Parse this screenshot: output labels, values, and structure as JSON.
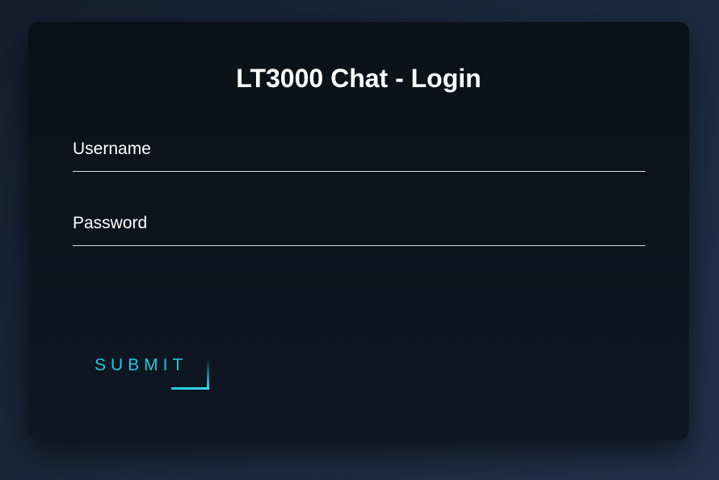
{
  "login": {
    "title": "LT3000 Chat - Login",
    "username": {
      "label": "Username",
      "value": ""
    },
    "password": {
      "label": "Password",
      "value": ""
    },
    "submit_label": "SUBMIT"
  },
  "colors": {
    "background": "#1c2a40",
    "card": "#0d151f",
    "text": "#ffffff",
    "accent": "#1fc9dc",
    "underline": "#d7dbe0"
  }
}
